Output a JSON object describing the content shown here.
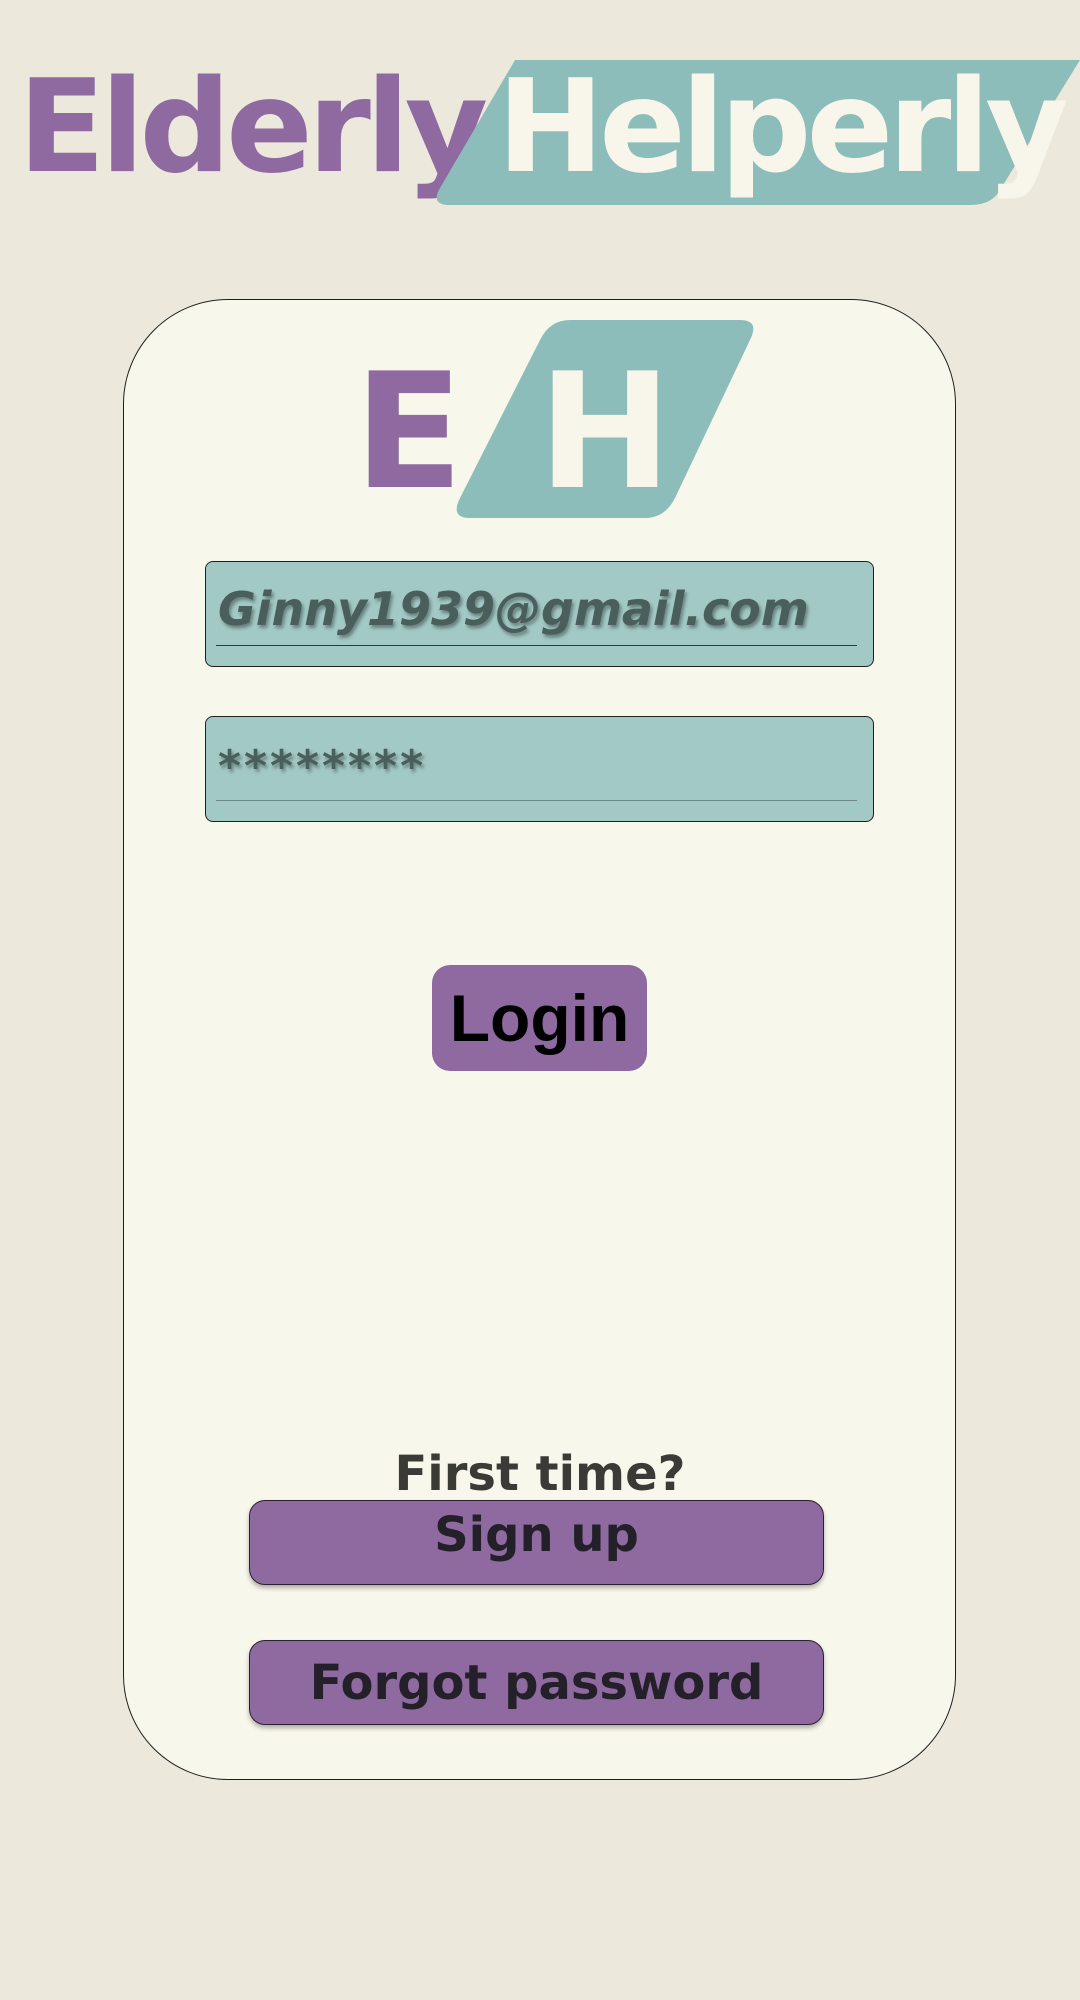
{
  "brand": {
    "word_left": "Elderly",
    "word_right": "Helperly",
    "mini_e": "E",
    "mini_h": "H"
  },
  "login_form": {
    "email_value": "Ginny1939@gmail.com",
    "password_value": "********",
    "login_label": "Login"
  },
  "footer": {
    "first_time_label": "First time?",
    "signup_label": "Sign up",
    "forgot_label": "Forgot password"
  },
  "colors": {
    "background": "#ECE9DC",
    "card": "#F8F7EC",
    "purple": "#8E6AA0",
    "teal": "#8DBDBA",
    "field": "#A2C9C4"
  }
}
